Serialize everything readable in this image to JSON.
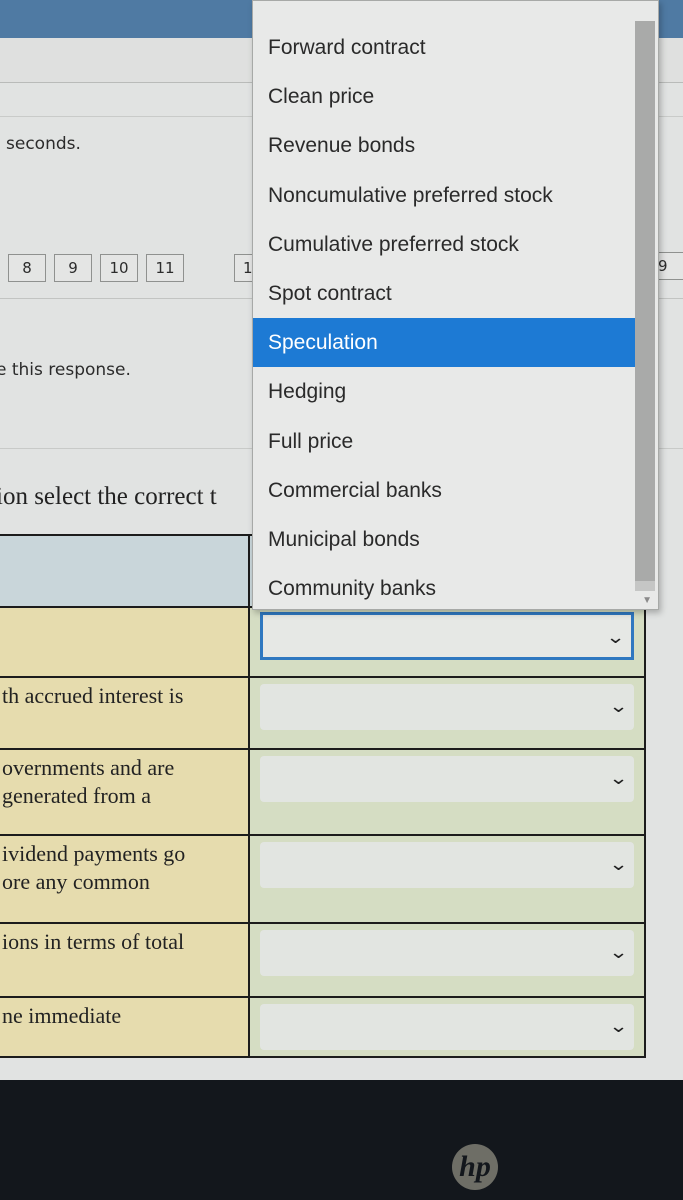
{
  "header": {
    "timer_text_fragment": "seconds."
  },
  "question_nav": {
    "buttons": [
      "8",
      "9",
      "10",
      "11"
    ],
    "partial_left": "1",
    "partial_right": "9"
  },
  "response_text_fragment": "e this response.",
  "instructions_fragment": "ion select the correct t",
  "matching_table": {
    "rows": [
      {
        "question": "",
        "answer": ""
      },
      {
        "question": "th accrued interest is",
        "answer": ""
      },
      {
        "question": "overnments and are\n generated from a",
        "answer": ""
      },
      {
        "question": "ividend payments go\nore any common",
        "answer": ""
      },
      {
        "question": "ions in terms of total",
        "answer": ""
      },
      {
        "question": "ne immediate",
        "answer": ""
      }
    ]
  },
  "dropdown": {
    "options": [
      "Forward contract",
      "Clean price",
      "Revenue bonds",
      "Noncumulative preferred stock",
      "Cumulative preferred stock",
      "Spot contract",
      "Speculation",
      "Hedging",
      "Full price",
      "Commercial banks",
      "Municipal bonds",
      "Community banks"
    ],
    "highlighted": "Speculation",
    "highlight_color": "#1d7ad4"
  },
  "icons": {
    "chevron": "⌄",
    "scroll_down": "▼",
    "logo": "hp"
  }
}
